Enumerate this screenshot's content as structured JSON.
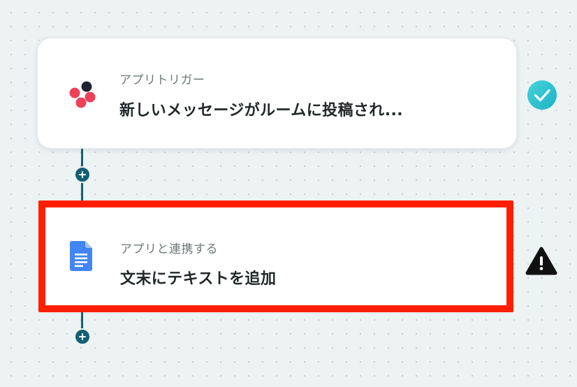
{
  "workflow": {
    "trigger_step": {
      "subtitle": "アプリトリガー",
      "title": "新しいメッセージがルームに投稿され...",
      "app_icon": "chatwork-icon",
      "status_icon": "check-circle-icon",
      "status_color": "#2fc7d2"
    },
    "action_step": {
      "subtitle": "アプリと連携する",
      "title": "文末にテキストを追加",
      "app_icon": "google-docs-icon",
      "status_icon": "warning-triangle-icon",
      "highlight_color": "#ff1f00"
    },
    "add_step_icon": "plus-icon",
    "connector_color": "#145f73"
  }
}
